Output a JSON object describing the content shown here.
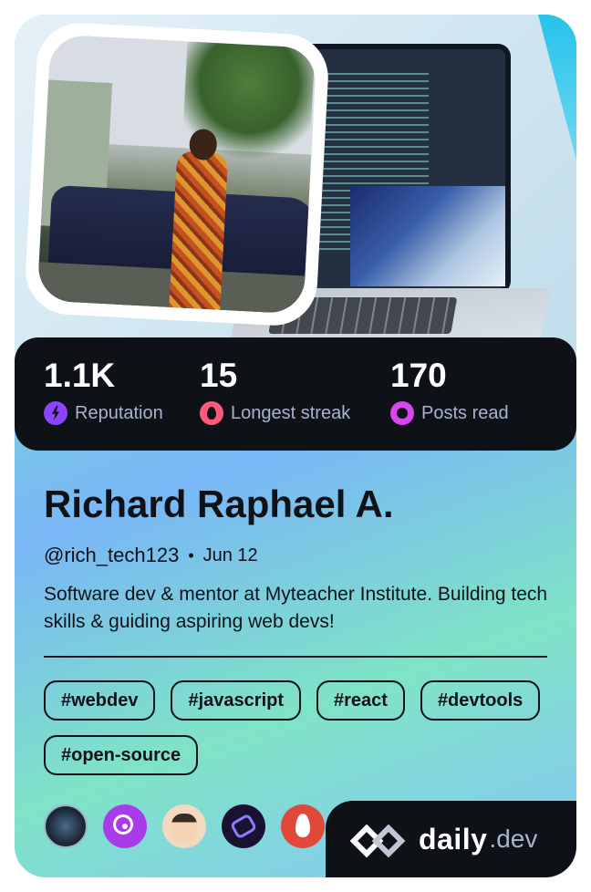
{
  "profile": {
    "name": "Richard Raphael A.",
    "handle": "@rich_tech123",
    "separator": "•",
    "joined": "Jun 12",
    "bio": "Software dev & mentor at Myteacher Institute. Building tech skills & guiding aspiring web devs!"
  },
  "stats": [
    {
      "value": "1.1K",
      "label": "Reputation",
      "icon": "lightning-icon",
      "color": "#8c44ff"
    },
    {
      "value": "15",
      "label": "Longest streak",
      "icon": "flame-icon",
      "color": "#ff5a7a"
    },
    {
      "value": "170",
      "label": "Posts read",
      "icon": "eye-icon",
      "color": "#d946ef"
    }
  ],
  "tags": [
    "#webdev",
    "#javascript",
    "#react",
    "#devtools",
    "#open-source"
  ],
  "badges": [
    "arm-squad-icon",
    "target-icon",
    "developer-avatar-icon",
    "link-squad-icon",
    "flame-squad-icon"
  ],
  "brand": {
    "primary": "daily",
    "secondary": ".dev"
  }
}
